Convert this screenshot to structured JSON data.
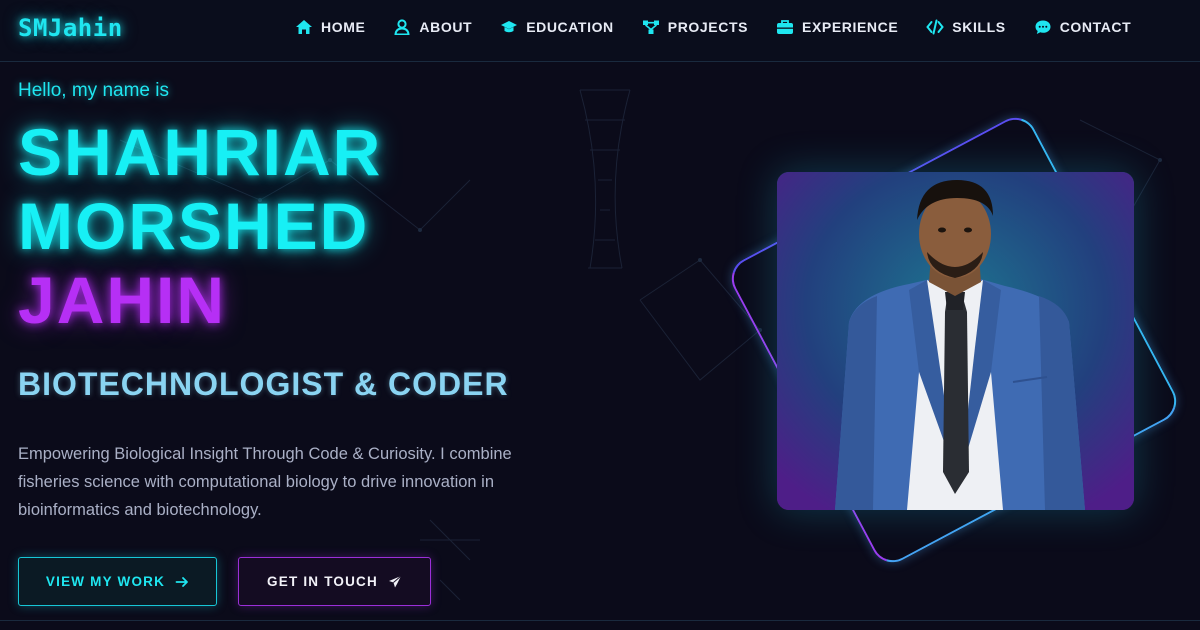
{
  "logo": "SMJahin",
  "nav": [
    {
      "label": "HOME",
      "icon": "home-icon"
    },
    {
      "label": "ABOUT",
      "icon": "user-icon"
    },
    {
      "label": "EDUCATION",
      "icon": "graduation-cap-icon"
    },
    {
      "label": "PROJECTS",
      "icon": "network-icon"
    },
    {
      "label": "EXPERIENCE",
      "icon": "briefcase-icon"
    },
    {
      "label": "SKILLS",
      "icon": "code-icon"
    },
    {
      "label": "CONTACT",
      "icon": "chat-icon"
    }
  ],
  "hero": {
    "greeting": "Hello, my name is",
    "name_line1": "SHAHRIAR",
    "name_line2": "MORSHED",
    "name_line3": "JAHIN",
    "role": "BIOTECHNOLOGIST & CODER",
    "description": "Empowering Biological Insight Through Code & Curiosity. I combine fisheries science with computational biology to drive innovation in bioinformatics and biotechnology.",
    "btn_work": "VIEW MY WORK",
    "btn_touch": "GET IN TOUCH"
  },
  "colors": {
    "accent_cyan": "#17f0f5",
    "accent_purple": "#b62ff5",
    "background": "#0b0b1a"
  }
}
